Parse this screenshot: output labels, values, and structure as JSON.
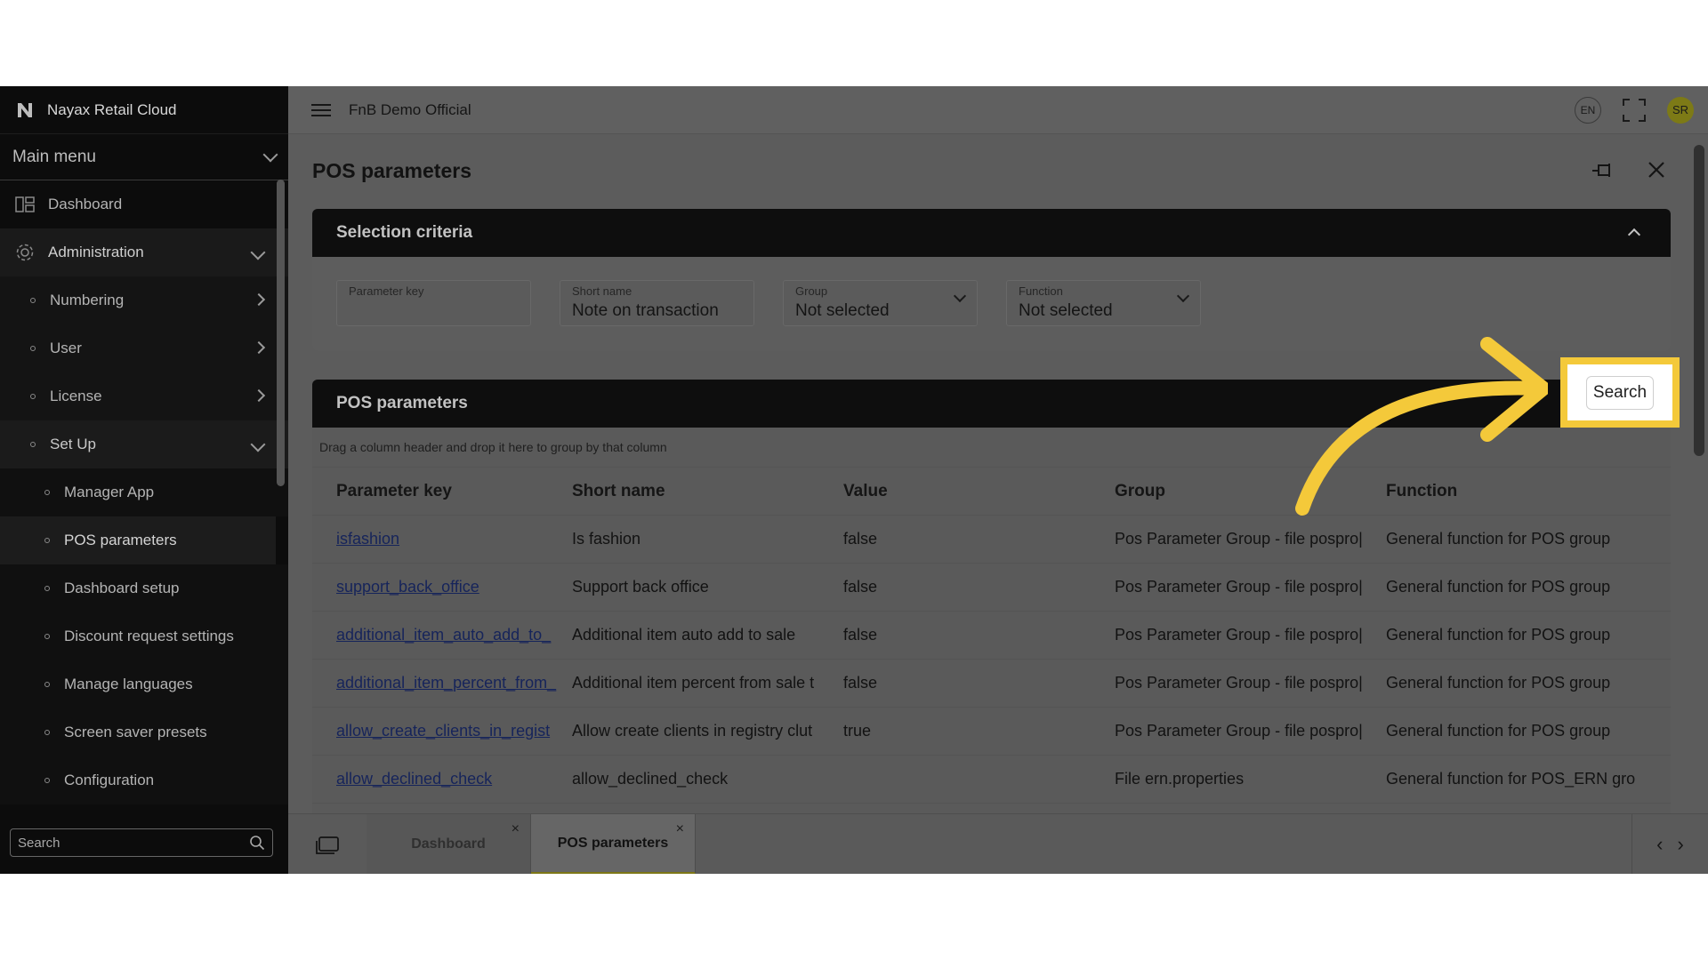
{
  "app": {
    "name": "Nayax Retail Cloud",
    "company": "FnB Demo Official"
  },
  "topbar": {
    "language": "EN",
    "user_initials": "SR"
  },
  "sidebar": {
    "main_menu_label": "Main menu",
    "items": [
      {
        "label": "Dashboard",
        "icon": "dashboard-icon"
      },
      {
        "label": "Administration",
        "icon": "gear-icon"
      }
    ],
    "admin_children": [
      {
        "label": "Numbering"
      },
      {
        "label": "User"
      },
      {
        "label": "License"
      },
      {
        "label": "Set Up"
      }
    ],
    "setup_children": [
      {
        "label": "Manager App"
      },
      {
        "label": "POS parameters"
      },
      {
        "label": "Dashboard setup"
      },
      {
        "label": "Discount request settings"
      },
      {
        "label": "Manage languages"
      },
      {
        "label": "Screen saver presets"
      },
      {
        "label": "Configuration"
      }
    ],
    "search_placeholder": "Search"
  },
  "page": {
    "title": "POS parameters"
  },
  "criteria": {
    "title": "Selection criteria",
    "fields": [
      {
        "label": "Parameter key",
        "value": ""
      },
      {
        "label": "Short name",
        "value": "Note on transaction"
      },
      {
        "label": "Group",
        "value": "Not selected"
      },
      {
        "label": "Function",
        "value": "Not selected"
      }
    ],
    "search_button": "Search"
  },
  "grid": {
    "title": "POS parameters",
    "drag_hint": "Drag a column header and drop it here to group by that column",
    "columns": [
      "Parameter key",
      "Short name",
      "Value",
      "Group",
      "Function"
    ],
    "rows": [
      [
        "isfashion",
        "Is fashion",
        "false",
        "Pos Parameter Group - file pospro|",
        "General function for POS group"
      ],
      [
        "support_back_office",
        "Support back office",
        "false",
        "Pos Parameter Group - file pospro|",
        "General function for POS group"
      ],
      [
        "additional_item_auto_add_to_",
        "Additional item auto add to sale",
        "false",
        "Pos Parameter Group - file pospro|",
        "General function for POS group"
      ],
      [
        "additional_item_percent_from_",
        "Additional item percent from sale t",
        "false",
        "Pos Parameter Group - file pospro|",
        "General function for POS group"
      ],
      [
        "allow_create_clients_in_regist",
        "Allow create clients in registry clut",
        "true",
        "Pos Parameter Group - file pospro|",
        "General function for POS group"
      ],
      [
        "allow_declined_check",
        "allow_declined_check",
        "",
        "File ern.properties",
        "General function for POS_ERN gro"
      ]
    ]
  },
  "tabs": [
    {
      "label": "Dashboard",
      "close": "×"
    },
    {
      "label": "POS parameters",
      "close": "×"
    }
  ],
  "colors": {
    "highlight": "#f4c93a",
    "accent": "#7d7716",
    "link": "#16245a"
  }
}
